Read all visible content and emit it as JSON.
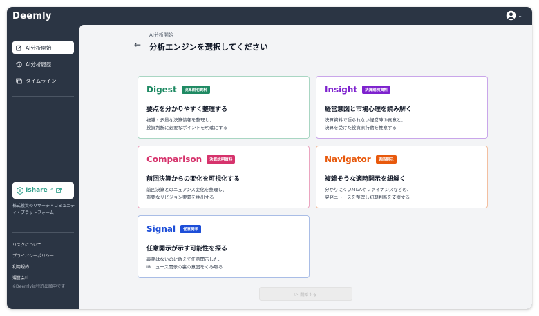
{
  "app": {
    "logo": "Deemly"
  },
  "sidebar": {
    "items": [
      {
        "label": "AI分析開始",
        "icon": "edit-square-icon",
        "active": true
      },
      {
        "label": "AI分析履歴",
        "icon": "history-icon",
        "active": false
      },
      {
        "label": "タイムライン",
        "icon": "timeline-icon",
        "active": false
      }
    ],
    "ishare": {
      "label": "Ishare",
      "icon": "external-link-icon"
    },
    "tagline": "株式投資のリサーチ・コミュニティ・プラットフォーム",
    "links": [
      "リスクについて",
      "プライバシーポリシー",
      "利用規約",
      "運営会社"
    ],
    "notice": "※Deemlyは特許出願中です"
  },
  "main": {
    "breadcrumb": "AI分析開始",
    "title": "分析エンジンを選択してください",
    "start_label": "開始する",
    "cards": [
      {
        "name": "Digest",
        "badge": "決算説明資料",
        "headline": "要点を分かりやすく整理する",
        "desc1": "複雑・多量な決算情報を整理し、",
        "desc2": "投資判断に必要なポイントを明確にする",
        "color": "#1f8a63",
        "border": "#a9d6c3"
      },
      {
        "name": "Insight",
        "badge": "決算説明資料",
        "headline": "経営意図と市場心理を読み解く",
        "desc1": "決算資料で語られない経営陣の真意と、",
        "desc2": "決算を受けた投資家行動を推察する",
        "color": "#7e22ce",
        "border": "#c9a6ea"
      },
      {
        "name": "Comparison",
        "badge": "決算説明資料",
        "headline": "前回決算からの変化を可視化する",
        "desc1": "前回決算とのニュアンス変化を整理し、",
        "desc2": "重要なリビジョン要素を抽出する",
        "color": "#d6336c",
        "border": "#eba5c0"
      },
      {
        "name": "Navigator",
        "badge": "適時開示",
        "headline": "複雑そうな適時開示を紐解く",
        "desc1": "分かりにくいM&Aやファイナンスなどの、",
        "desc2": "突発ニュースを整理し初期判断を支援する",
        "color": "#e8590c",
        "border": "#f3bfa0"
      },
      {
        "name": "Signal",
        "badge": "任意開示",
        "headline": "任意開示が示す可能性を探る",
        "desc1": "義務はないのに敢えて任意開示した、",
        "desc2": "IRニュース開示の裏の意図をくみ取る",
        "color": "#1d4ed8",
        "border": "#a9bde6"
      }
    ]
  }
}
